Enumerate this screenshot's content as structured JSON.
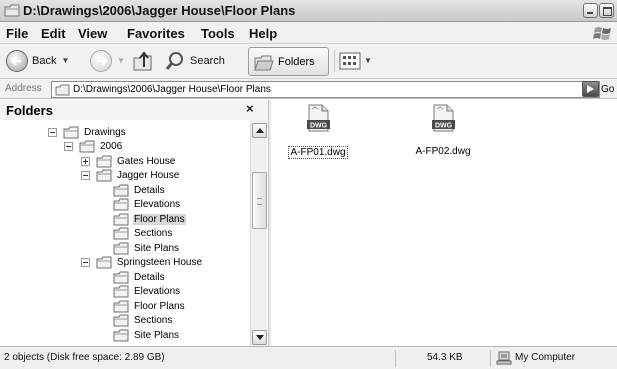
{
  "window": {
    "title": "D:\\Drawings\\2006\\Jagger House\\Floor Plans"
  },
  "menu": [
    "File",
    "Edit",
    "View",
    "Favorites",
    "Tools",
    "Help"
  ],
  "toolbar": {
    "back_label": "Back",
    "search_label": "Search",
    "folders_label": "Folders"
  },
  "address": {
    "label": "Address",
    "value": "D:\\Drawings\\2006\\Jagger House\\Floor Plans",
    "go_label": "Go"
  },
  "folders_pane": {
    "title": "Folders",
    "close": "×",
    "tree": [
      {
        "label": "Drawings",
        "level": 0,
        "expander": "minus"
      },
      {
        "label": "2006",
        "level": 1,
        "expander": "minus"
      },
      {
        "label": "Gates House",
        "level": 2,
        "expander": "plus"
      },
      {
        "label": "Jagger House",
        "level": 2,
        "expander": "minus"
      },
      {
        "label": "Details",
        "level": 3,
        "expander": "none"
      },
      {
        "label": "Elevations",
        "level": 3,
        "expander": "none"
      },
      {
        "label": "Floor Plans",
        "level": 3,
        "expander": "none",
        "selected": true
      },
      {
        "label": "Sections",
        "level": 3,
        "expander": "none"
      },
      {
        "label": "Site Plans",
        "level": 3,
        "expander": "none"
      },
      {
        "label": "Springsteen House",
        "level": 2,
        "expander": "minus"
      },
      {
        "label": "Details",
        "level": 3,
        "expander": "none"
      },
      {
        "label": "Elevations",
        "level": 3,
        "expander": "none"
      },
      {
        "label": "Floor Plans",
        "level": 3,
        "expander": "none"
      },
      {
        "label": "Sections",
        "level": 3,
        "expander": "none"
      },
      {
        "label": "Site Plans",
        "level": 3,
        "expander": "none"
      }
    ]
  },
  "files": [
    {
      "name": "A-FP01.dwg",
      "icon_text": "DWG",
      "focused": true
    },
    {
      "name": "A-FP02.dwg",
      "icon_text": "DWG",
      "focused": false
    }
  ],
  "status": {
    "objects": "2 objects (Disk free space: 2.89 GB)",
    "size": "54.3 KB",
    "zone": "My Computer"
  },
  "icons": {
    "window": "folder-icon",
    "back": "back-arrow-icon",
    "forward": "forward-arrow-icon",
    "up": "up-folder-icon",
    "search": "magnifier-icon",
    "folders": "folders-icon",
    "views": "views-icon",
    "go": "go-arrow-icon",
    "zone": "computer-icon",
    "windows_logo": "windows-flag-icon"
  }
}
